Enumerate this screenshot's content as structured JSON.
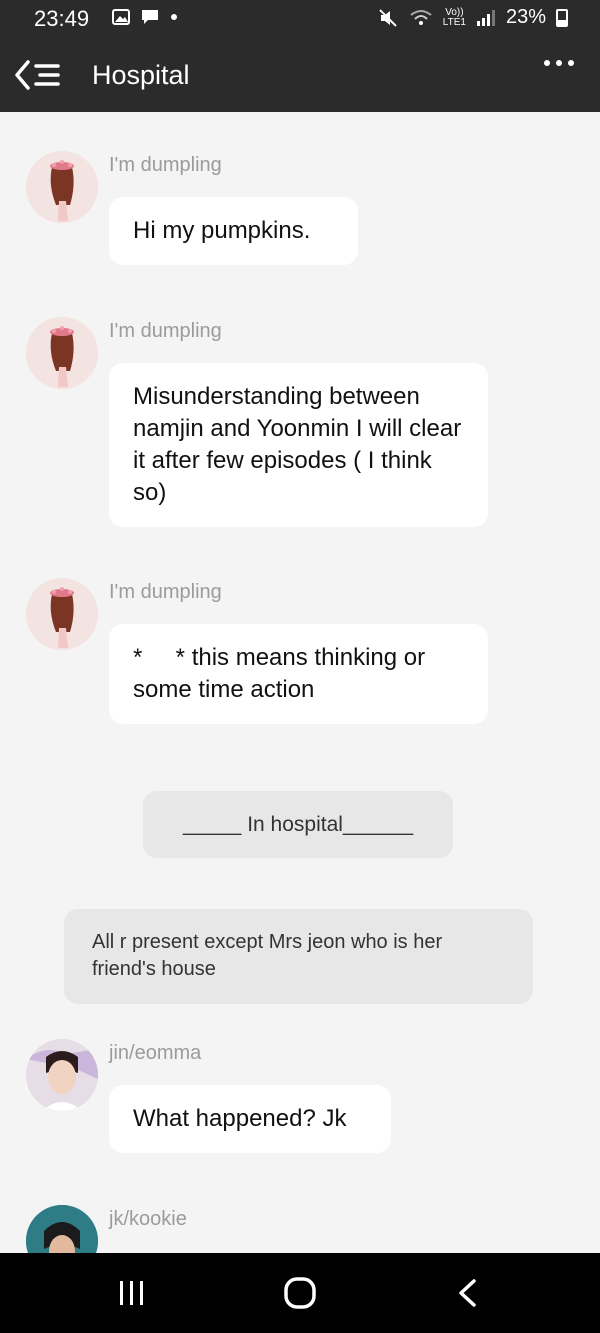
{
  "status_bar": {
    "time": "23:49",
    "network_top": "Vo))",
    "network_bottom": "LTE1",
    "battery": "23%"
  },
  "app_bar": {
    "title": "Hospital"
  },
  "messages": [
    {
      "sender": "I'm dumpling",
      "text": "Hi my pumpkins."
    },
    {
      "sender": "I'm dumpling",
      "text": "Misunderstanding between namjin and Yoonmin I will clear it after few episodes ( I think so)"
    },
    {
      "sender": "I'm dumpling",
      "text": "*     * this means thinking or some time action"
    },
    {
      "narration": "_____ In hospital______"
    },
    {
      "narration": "All r present except Mrs jeon who is her friend's house"
    },
    {
      "sender": "jin/eomma",
      "text": "What happened? Jk"
    },
    {
      "sender": "jk/kookie"
    }
  ],
  "colors": {
    "bar_bg": "#2b2b2b",
    "chat_bg": "#f4f4f4",
    "bubble_bg": "#ffffff",
    "narration_bg": "#e7e7e7",
    "sender_text": "#9b9b9b"
  }
}
